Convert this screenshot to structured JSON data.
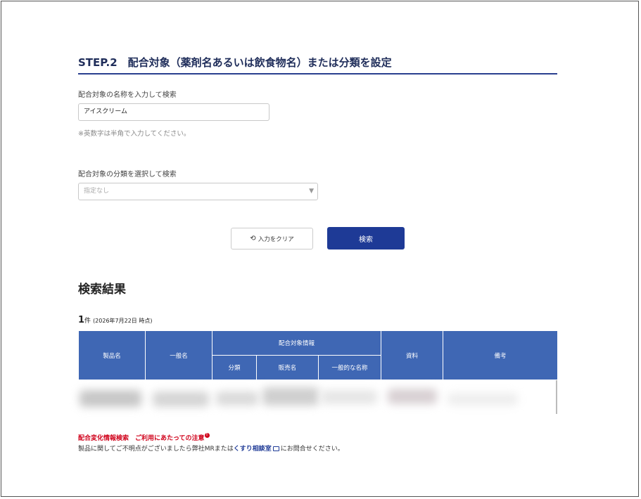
{
  "step": {
    "title": "STEP.2　配合対象（薬剤名あるいは飲食物名）または分類を設定"
  },
  "name_search": {
    "label": "配合対象の名称を入力して検索",
    "value": "アイスクリーム",
    "note": "※英数字は半角で入力してください。"
  },
  "category_search": {
    "label": "配合対象の分類を選択して検索",
    "selected": "指定なし"
  },
  "buttons": {
    "clear_label": "入力をクリア",
    "search_label": "検索"
  },
  "results": {
    "title": "検索結果",
    "count": "1",
    "count_unit": "件",
    "date_note": "(2026年7月22日 時点)",
    "columns": {
      "product": "製品名",
      "generic": "一般名",
      "target_info": "配合対象情報",
      "category": "分類",
      "brand": "販売名",
      "general_name": "一般的な名称",
      "materials": "資料",
      "remarks": "備考"
    }
  },
  "footer": {
    "caution_text": "配合変化情報検索　ご利用にあたっての注意",
    "contact_prefix": "製品に関してご不明点がございましたら弊社MRまたは",
    "contact_link": "くすり相談室",
    "contact_suffix": "にお問合せください。"
  },
  "colors": {
    "primary": "#1e3a96",
    "table_header": "#3f67b4",
    "caution": "#d0021b"
  },
  "icons": {
    "clear": "refresh-icon",
    "select": "caret-down-icon",
    "external": "window-icon"
  }
}
